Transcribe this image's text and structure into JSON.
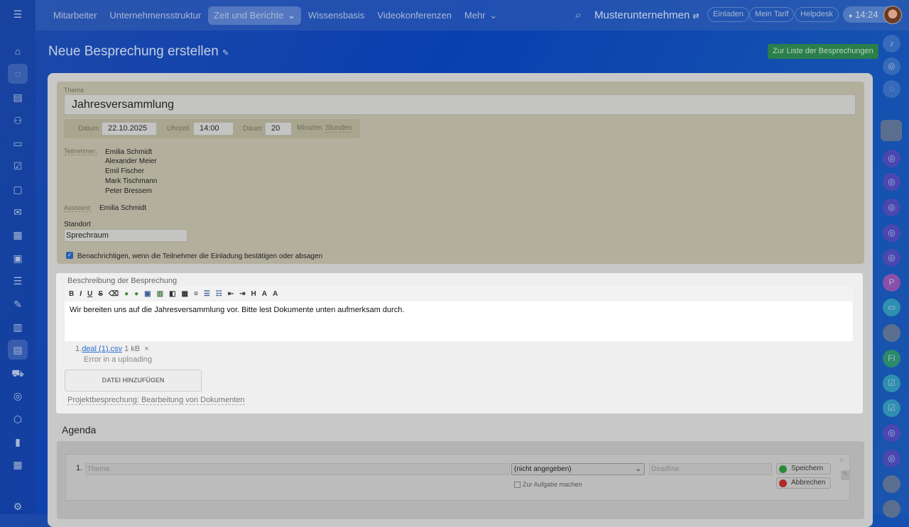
{
  "topbar": {
    "nav": [
      "Mitarbeiter",
      "Unternehmensstruktur",
      "Zeit und Berichte",
      "Wissensbasis",
      "Videokonferenzen",
      "Mehr"
    ],
    "company": "Musterunternehmen",
    "invite": "Einladen",
    "tariff": "Mein Tarif",
    "helpdesk": "Helpdesk",
    "time": "14:24"
  },
  "page": {
    "title": "Neue Besprechung erstellen",
    "list_button": "Zur Liste der Besprechungen"
  },
  "form": {
    "topic_label": "Thema",
    "topic_value": "Jahresversammlung",
    "date_label": "Datum",
    "date_value": "22.10.2025",
    "time_label": "Uhrzeit",
    "time_value": "14:00",
    "duration_label": "Dauer",
    "duration_value": "20",
    "unit_minutes": "Minuten",
    "unit_hours": "Stunden",
    "participants_label": "Teilnehmer:",
    "participants": [
      "Emilia Schmidt",
      "Alexander Meier",
      "Emil Fischer",
      "Mark Tischmann",
      "Peter Bressem"
    ],
    "assistant_label": "Assistent:",
    "assistant_value": "Emilia Schmidt",
    "location_label": "Standort",
    "location_value": "Sprechraum",
    "notify_label": "Benachrichtigen, wenn die Teilnehmer die Einladung bestätigen oder absagen",
    "notify_checked": true
  },
  "description": {
    "label": "Beschreibung der Besprechung",
    "text": "Wir bereiten uns auf die Jahresversammlung vor. Bitte lest Dokumente unten aufmerksam durch.",
    "file_index": "1.",
    "file_name": "deal (1).csv",
    "file_size": "1 kB",
    "file_error": "Error in a uploading",
    "add_file": "DATEI HINZUFÜGEN",
    "related": "Projektbesprechung: Bearbeitung von Dokumenten"
  },
  "agenda": {
    "title": "Agenda",
    "item_index": "1.",
    "topic_placeholder": "Thema",
    "responsible": "(nicht angegeben)",
    "deadline_placeholder": "Deadline",
    "make_task": "Zur Aufgabe machen",
    "save": "Speichern",
    "cancel": "Abbrechen"
  }
}
